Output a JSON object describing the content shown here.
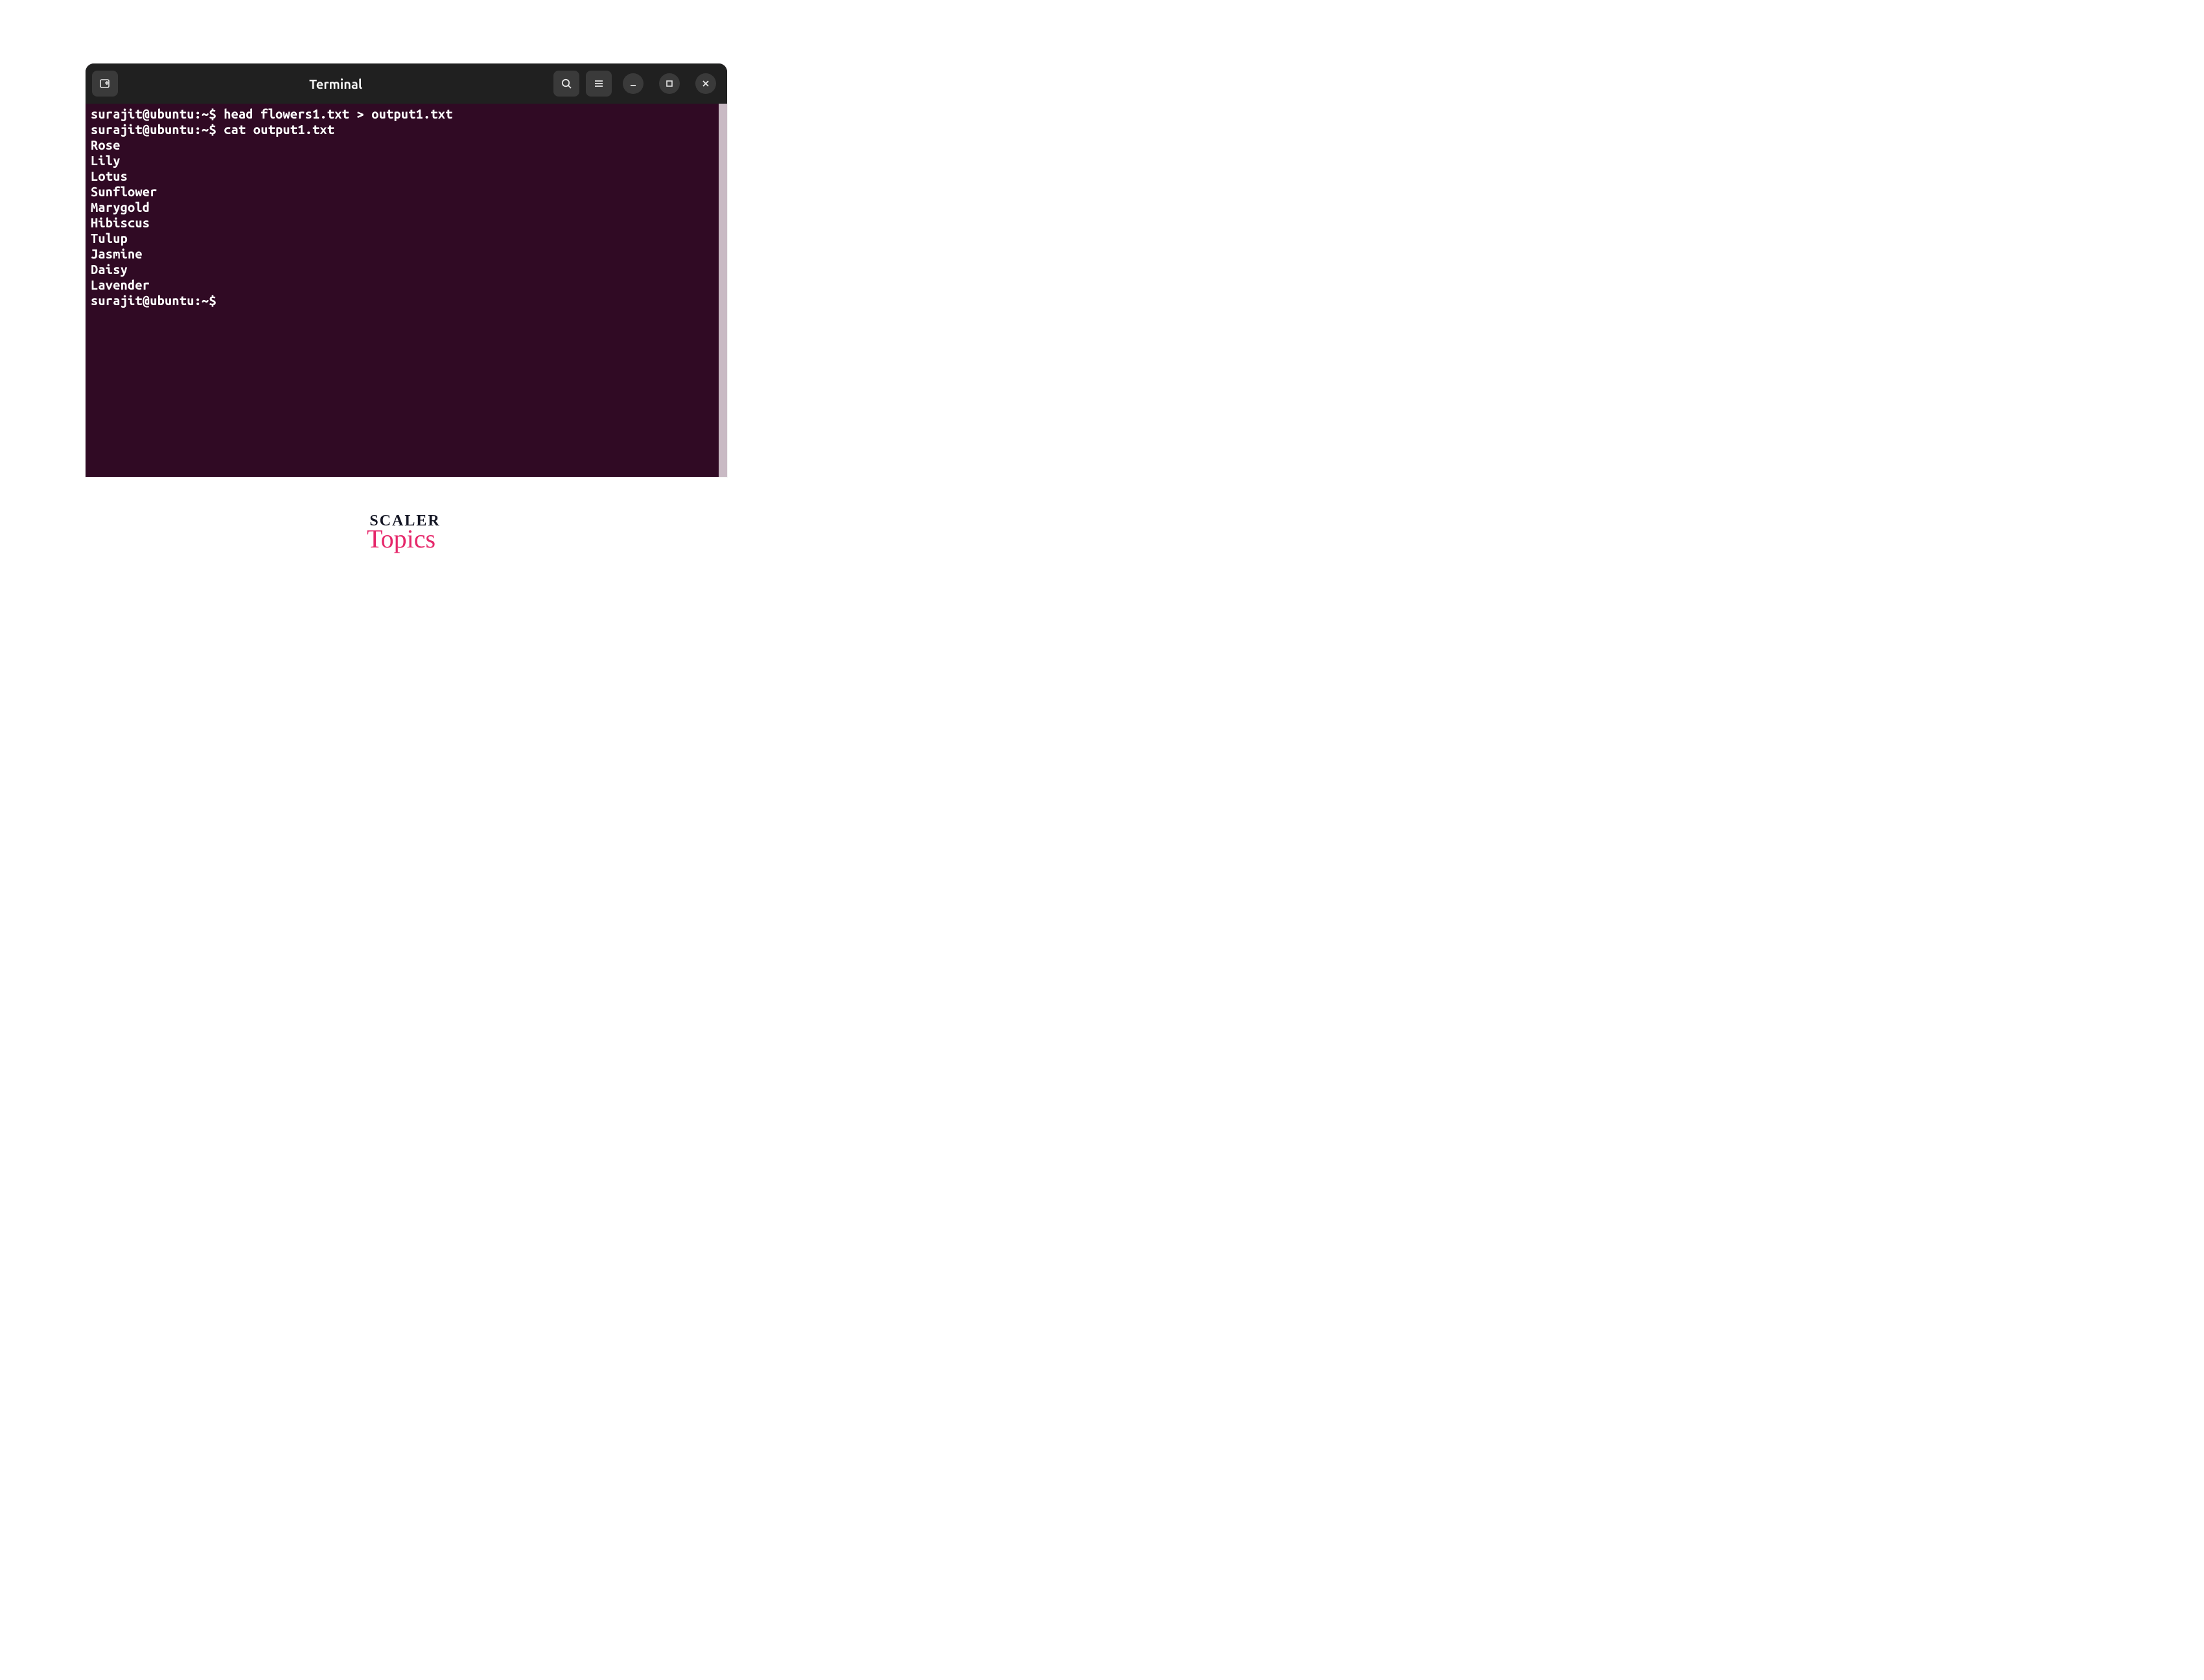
{
  "window": {
    "title": "Terminal"
  },
  "session": {
    "prompt_user_host": "surajit@ubuntu",
    "prompt_path": "~",
    "prompt_symbol": "$",
    "lines": [
      {
        "kind": "cmd",
        "text": "head flowers1.txt > output1.txt"
      },
      {
        "kind": "cmd",
        "text": "cat output1.txt"
      },
      {
        "kind": "out",
        "text": "Rose"
      },
      {
        "kind": "out",
        "text": "Lily"
      },
      {
        "kind": "out",
        "text": "Lotus"
      },
      {
        "kind": "out",
        "text": "Sunflower"
      },
      {
        "kind": "out",
        "text": "Marygold"
      },
      {
        "kind": "out",
        "text": "Hibiscus"
      },
      {
        "kind": "out",
        "text": "Tulup"
      },
      {
        "kind": "out",
        "text": "Jasmine"
      },
      {
        "kind": "out",
        "text": "Daisy"
      },
      {
        "kind": "out",
        "text": "Lavender"
      },
      {
        "kind": "cmd",
        "text": ""
      }
    ]
  },
  "branding": {
    "line1": "SCALER",
    "line2": "Topics"
  },
  "colors": {
    "titlebarBg": "#202020",
    "terminalBg": "#300a24",
    "terminalFg": "#ffffff",
    "accentPink": "#e6286b"
  }
}
